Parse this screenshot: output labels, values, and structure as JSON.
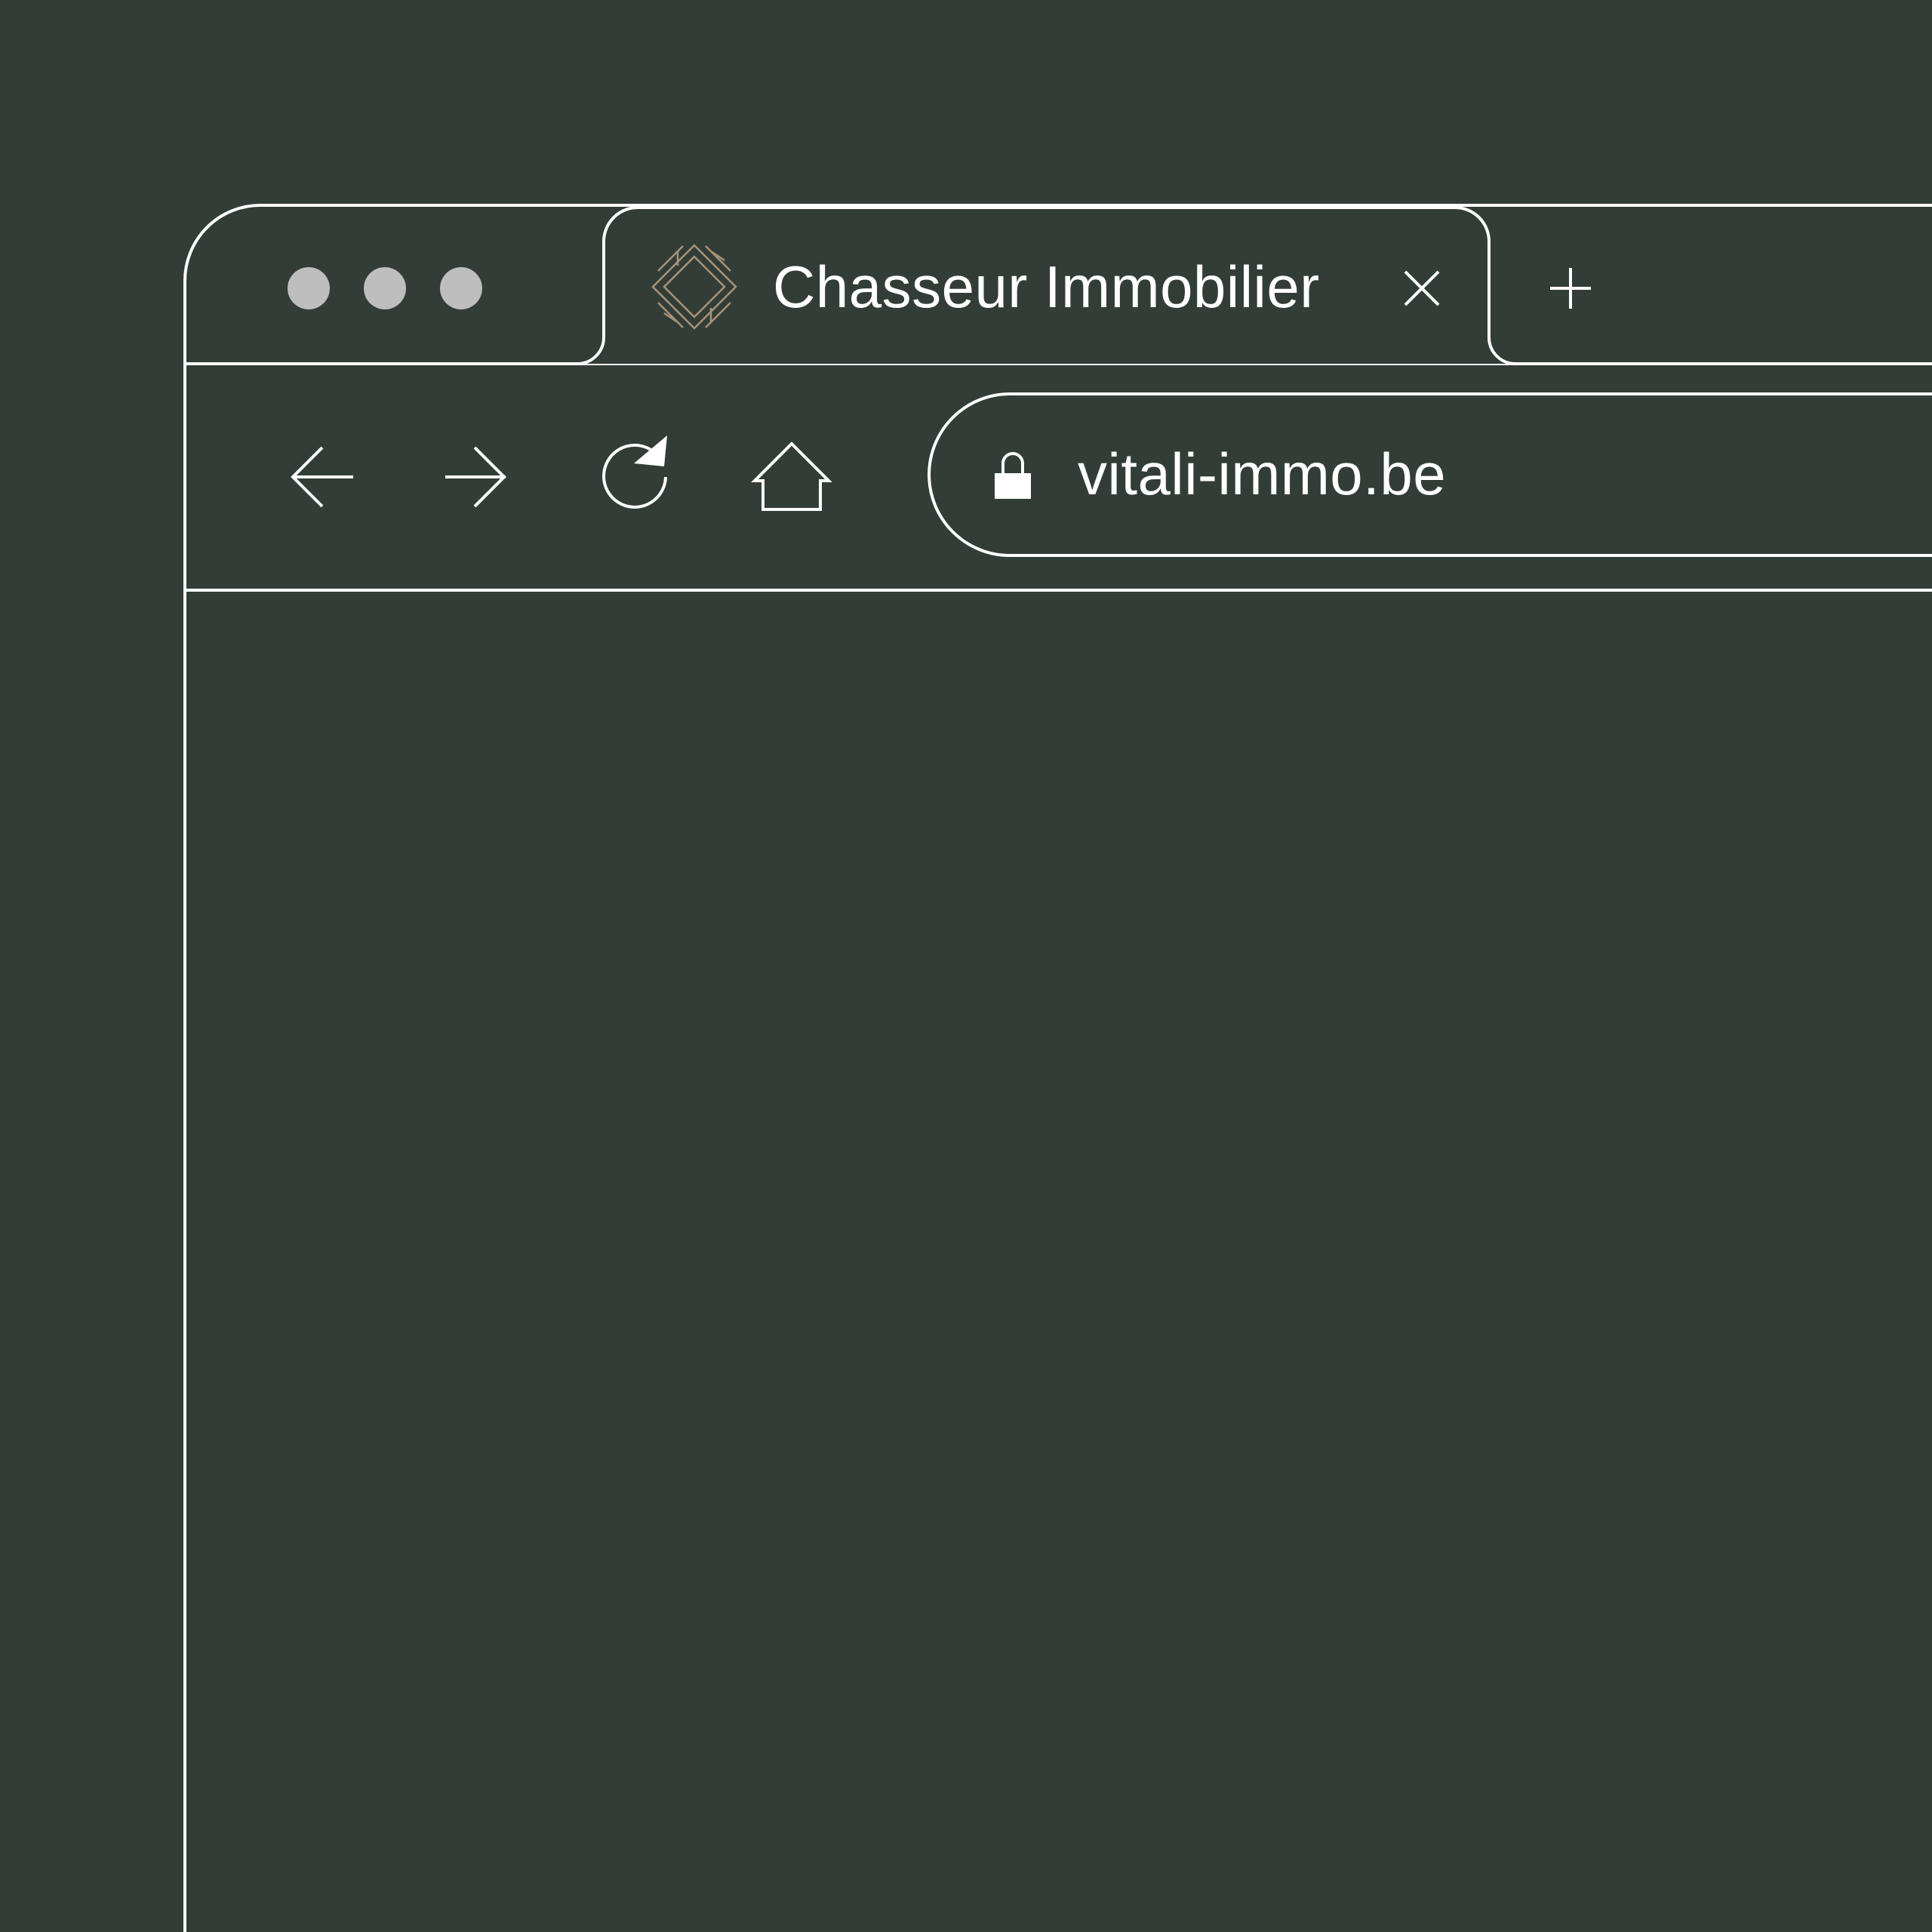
{
  "window": {
    "controls": [
      "close",
      "minimize",
      "maximize"
    ],
    "control_color": "#bfbebf"
  },
  "tab": {
    "title": "Chasseur Immobilier",
    "favicon": "vitali-logo-icon",
    "favicon_color": "#a89478",
    "close_icon": "close-icon"
  },
  "new_tab_icon": "plus-icon",
  "toolbar": {
    "back_icon": "arrow-left-icon",
    "forward_icon": "arrow-right-icon",
    "reload_icon": "reload-icon",
    "home_icon": "home-icon"
  },
  "address_bar": {
    "lock_icon": "lock-icon",
    "url": "vitali-immo.be"
  },
  "colors": {
    "background": "#333d38",
    "outline": "#ffffff"
  }
}
